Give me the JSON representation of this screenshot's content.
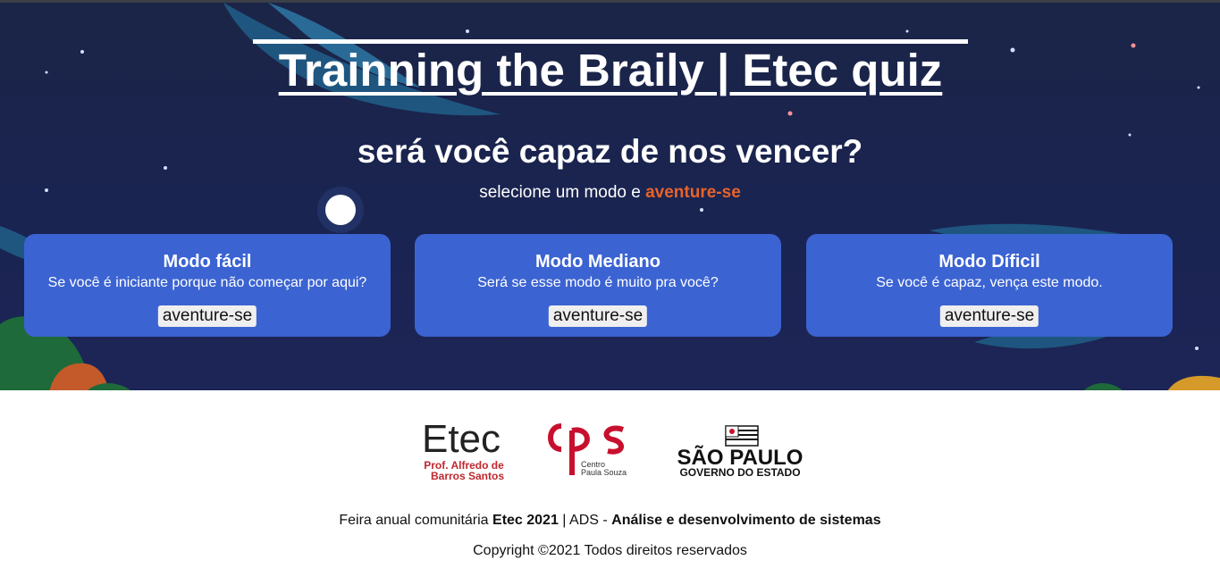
{
  "hero": {
    "title": "Trainning the Braily | Etec quiz",
    "subtitle": "será você capaz de nos vencer?",
    "tagline_prefix": "selecione um modo e ",
    "tagline_accent": "aventure-se",
    "accent_color": "#e8632a"
  },
  "modes": [
    {
      "title": "Modo fácil",
      "description": "Se você é iniciante porque não começar por aqui?",
      "button_label": "aventure-se"
    },
    {
      "title": "Modo Mediano",
      "description": "Será se esse modo é muito pra você?",
      "button_label": "aventure-se"
    },
    {
      "title": "Modo Díficil",
      "description": "Se você é capaz, vença este modo.",
      "button_label": "aventure-se"
    }
  ],
  "logos": {
    "etec": {
      "name": "Etec",
      "line1": "Prof. Alfredo de",
      "line2": "Barros Santos"
    },
    "cps": {
      "mark": "cps",
      "line1": "Centro",
      "line2": "Paula Souza"
    },
    "sp": {
      "name": "SÃO PAULO",
      "sub": "GOVERNO DO ESTADO"
    }
  },
  "footer": {
    "fair_prefix": "Feira anual comunitária ",
    "fair_event": "Etec 2021",
    "fair_mid": " | ADS - ",
    "fair_course": "Análise e desenvolvimento de sistemas",
    "copyright": "Copyright ©2021 Todos direitos reservados"
  },
  "colors": {
    "hero_bg": "#1b2547",
    "card_bg": "#3b63d2",
    "etec_red": "#c0272d",
    "cps_red": "#c8102e"
  }
}
